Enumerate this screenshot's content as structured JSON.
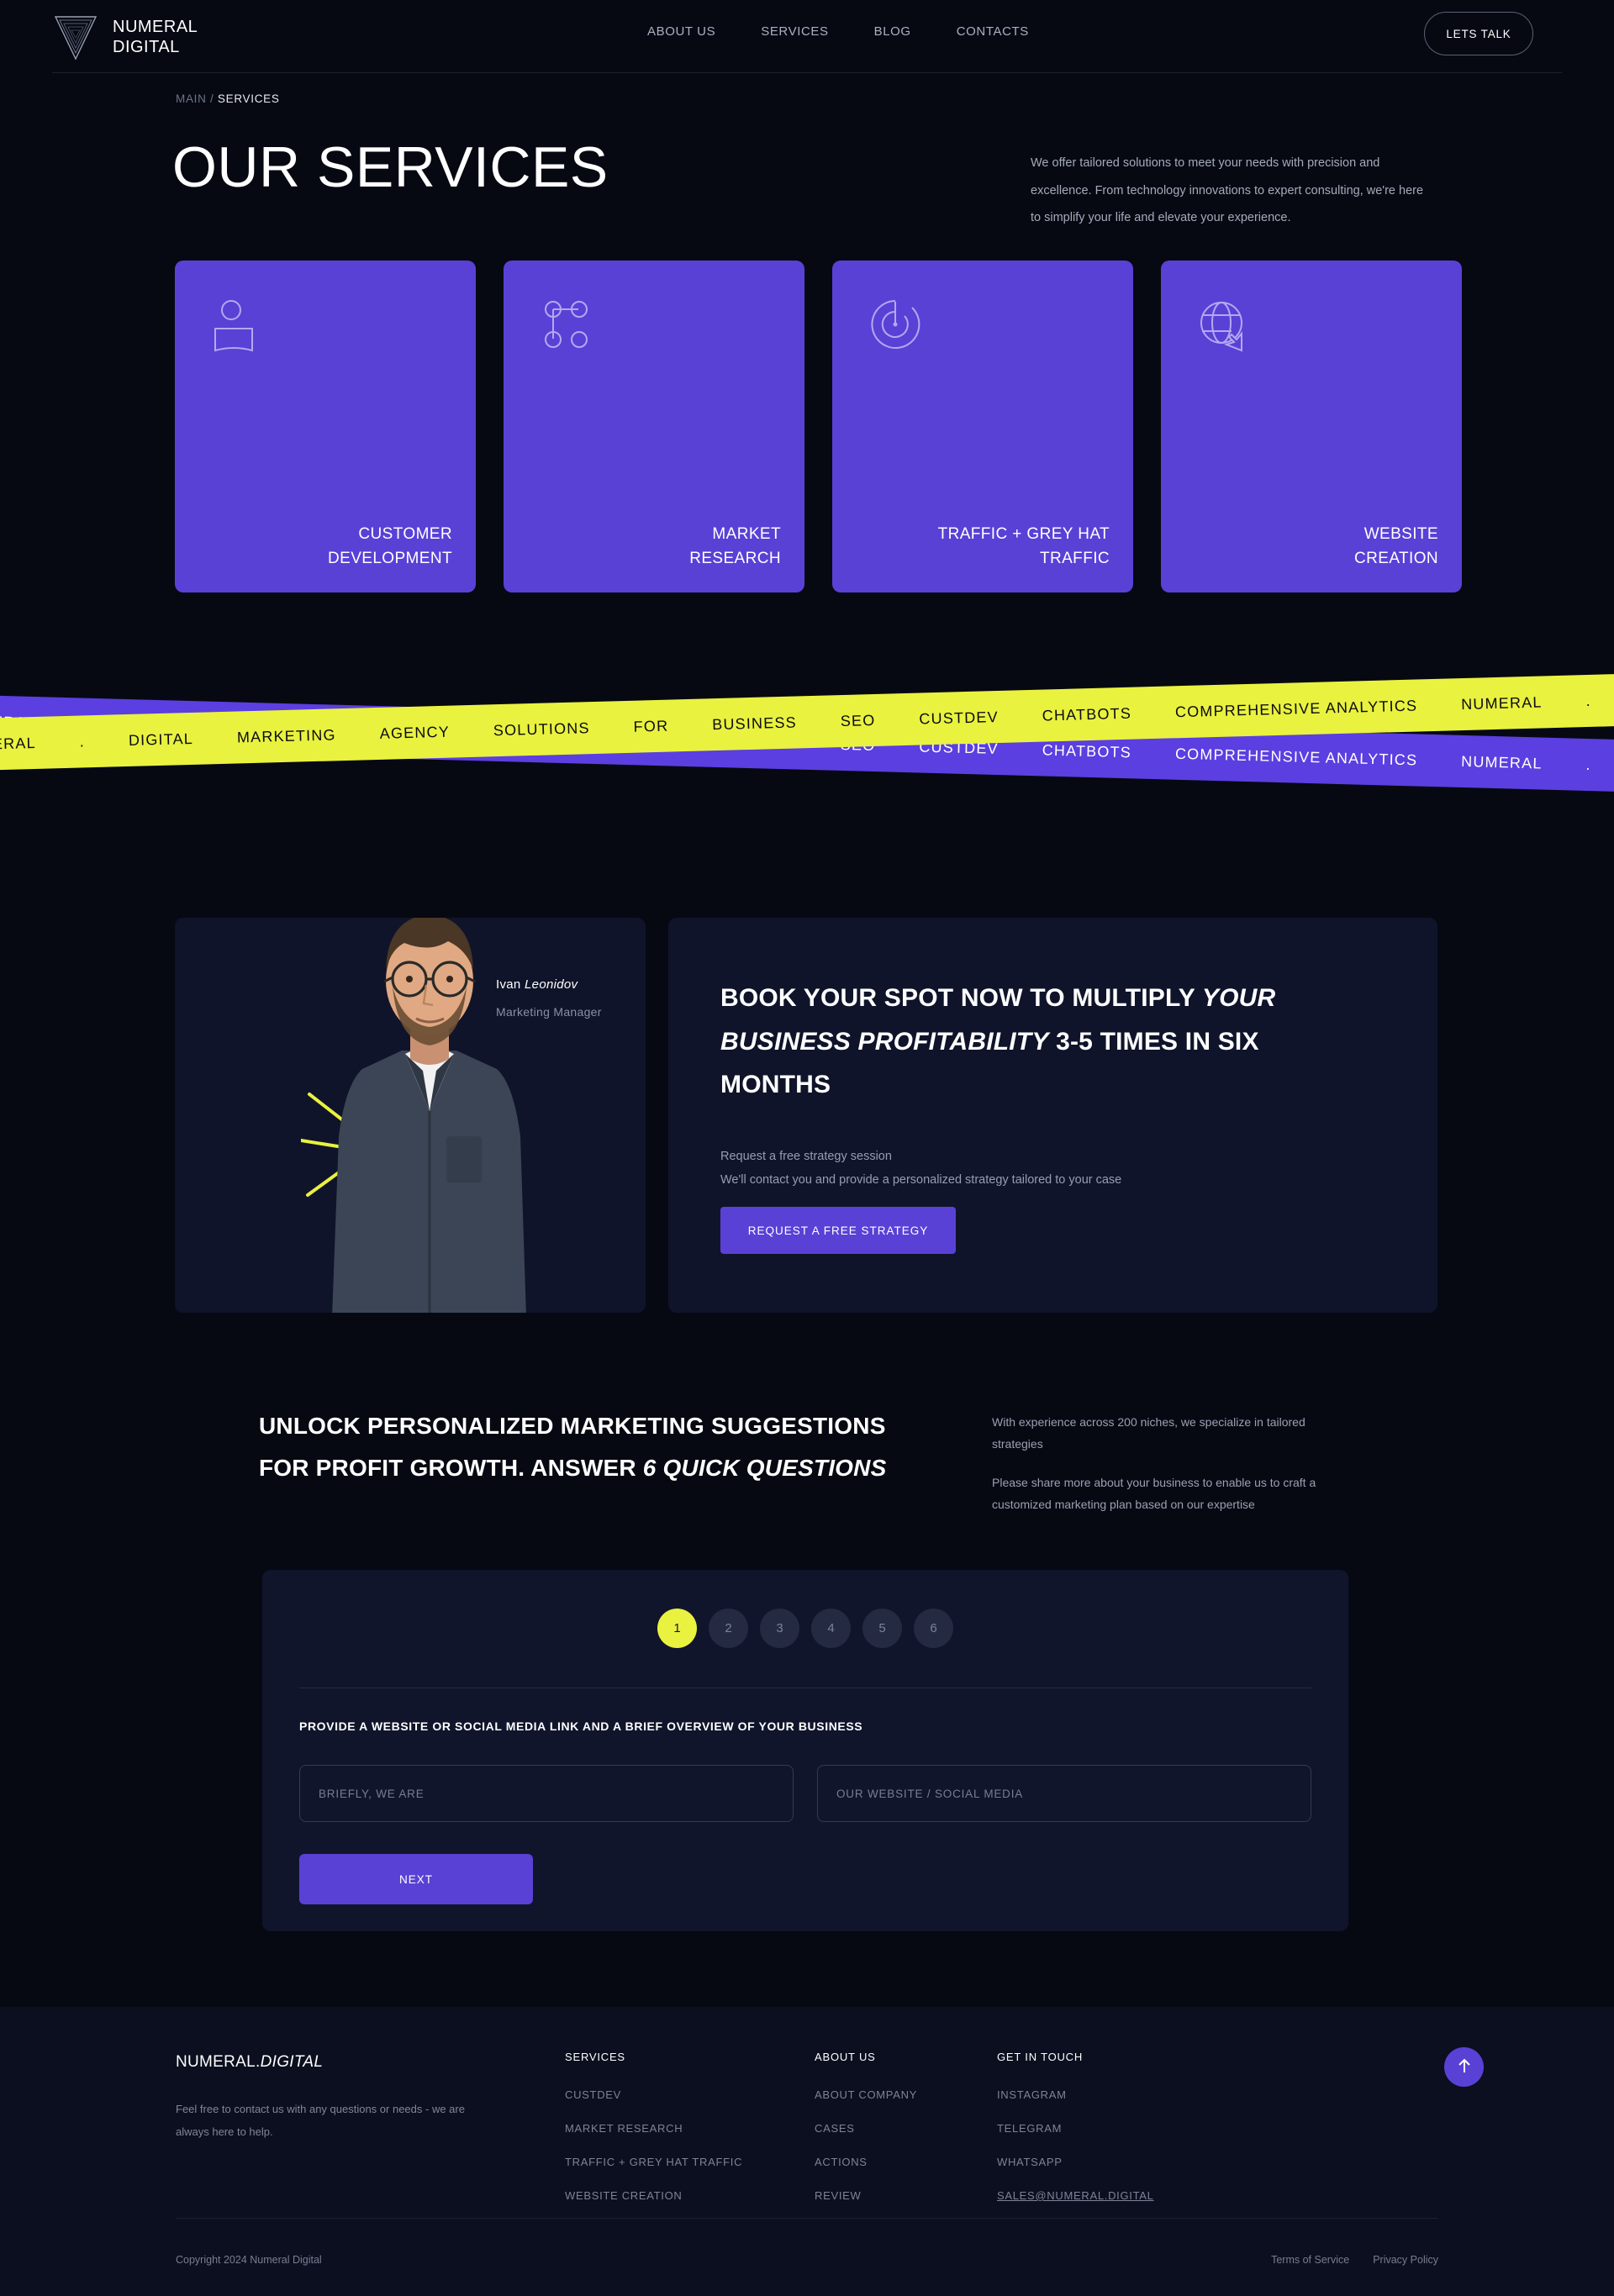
{
  "header": {
    "logo_line1": "NUMERAL",
    "logo_line2": "DIGITAL",
    "nav": [
      {
        "label": "ABOUT US"
      },
      {
        "label": "SERVICES"
      },
      {
        "label": "BLOG"
      },
      {
        "label": "CONTACTS"
      }
    ],
    "cta_label": "LETS TALK"
  },
  "hero": {
    "breadcrumb_root": "MAIN",
    "breadcrumb_sep": " / ",
    "breadcrumb_current": "SERVICES",
    "title": "OUR SERVICES",
    "description": "We offer tailored solutions to meet your needs with precision and excellence. From technology innovations to expert consulting, we're here to simplify your life and elevate your experience."
  },
  "services": {
    "accent_color": "#5941d6",
    "cards": [
      {
        "icon": "person-icon",
        "line1": "CUSTOMER",
        "line2": "DEVELOPMENT"
      },
      {
        "icon": "network-nodes-icon",
        "line1": "MARKET",
        "line2": "RESEARCH"
      },
      {
        "icon": "radar-icon",
        "line1": "TRAFFIC + GREY HAT",
        "line2": "TRAFFIC"
      },
      {
        "icon": "globe-cursor-icon",
        "line1": "WEBSITE",
        "line2": "CREATION"
      }
    ]
  },
  "marquee": {
    "yellow_color": "#e9f23f",
    "purple_color": "#5b3fe0",
    "items": [
      "NUMERAL",
      ".",
      "DIGITAL",
      "MARKETING",
      "AGENCY",
      "SOLUTIONS",
      "FOR",
      "BUSINESS",
      "SEO",
      "CUSTDEV",
      "CHATBOTS",
      "COMPREHENSIVE ANALYTICS"
    ]
  },
  "book": {
    "person_name_first": "Ivan ",
    "person_name_last": "Leonidov",
    "person_role": "Marketing Manager",
    "heading_1": "BOOK YOUR SPOT NOW TO MULTIPLY ",
    "heading_2": "YOUR BUSINESS PROFITABILITY",
    "heading_3": " 3-5 TIMES IN SIX MONTHS",
    "sub_line_1": "Request a free strategy session",
    "sub_line_2": "We'll contact you and provide a personalized strategy tailored to your case",
    "button_label": "REQUEST A FREE STRATEGY"
  },
  "quiz": {
    "heading_1": "UNLOCK PERSONALIZED MARKETING SUGGESTIONS FOR PROFIT GROWTH. ANSWER ",
    "heading_2": "6 QUICK QUESTIONS",
    "aside_1": "With experience across 200 niches, we specialize in tailored strategies",
    "aside_2": "Please share more about your business to enable us to craft a customized marketing plan based on our expertise",
    "steps": [
      "1",
      "2",
      "3",
      "4",
      "5",
      "6"
    ],
    "active_step": "1",
    "active_step_color": "#e9f23f",
    "question": "PROVIDE A WEBSITE OR SOCIAL MEDIA LINK AND A BRIEF OVERVIEW OF YOUR BUSINESS",
    "input_1_placeholder": "BRIEFLY, WE ARE",
    "input_1_value": "",
    "input_2_placeholder": "OUR WEBSITE / SOCIAL MEDIA",
    "input_2_value": "",
    "next_label": "NEXT"
  },
  "footer": {
    "brand_1": "NUMERAL.",
    "brand_2": "DIGITAL",
    "note": "Feel free to contact us with any questions or needs - we are always here to help.",
    "col_services": {
      "title": "SERVICES",
      "links": [
        "CUSTDEV",
        "MARKET RESEARCH",
        "TRAFFIC + GREY HAT TRAFFIC",
        "WEBSITE CREATION"
      ]
    },
    "col_about": {
      "title": "ABOUT US",
      "links": [
        "ABOUT COMPANY",
        "CASES",
        "ACTIONS",
        "REVIEW"
      ]
    },
    "col_touch": {
      "title": "GET IN TOUCH",
      "links": [
        "INSTAGRAM",
        "TELEGRAM",
        "WHATSAPP"
      ],
      "email": "SALES@NUMERAL.DIGITAL"
    },
    "copyright": "Copyright 2024 Numeral Digital",
    "legal": [
      "Terms of Service",
      "Privacy Policy"
    ]
  }
}
